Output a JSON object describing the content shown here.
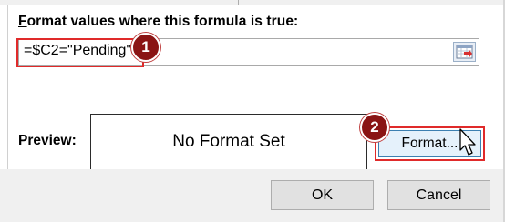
{
  "rule": {
    "label_first_letter": "F",
    "label_rest": "ormat values where this formula is true:",
    "formula_value": "=$C2=\"Pending\""
  },
  "preview": {
    "label": "Preview:",
    "text": "No Format Set"
  },
  "buttons": {
    "format_label": "Format...",
    "ok_label": "OK",
    "cancel_label": "Cancel"
  },
  "annotations": {
    "step1": "1",
    "step2": "2",
    "color": "#e02a2a",
    "badge_color": "#8a1414"
  },
  "icons": {
    "range_selector": "collapse-dialog-icon",
    "pointer": "mouse-pointer-icon"
  }
}
